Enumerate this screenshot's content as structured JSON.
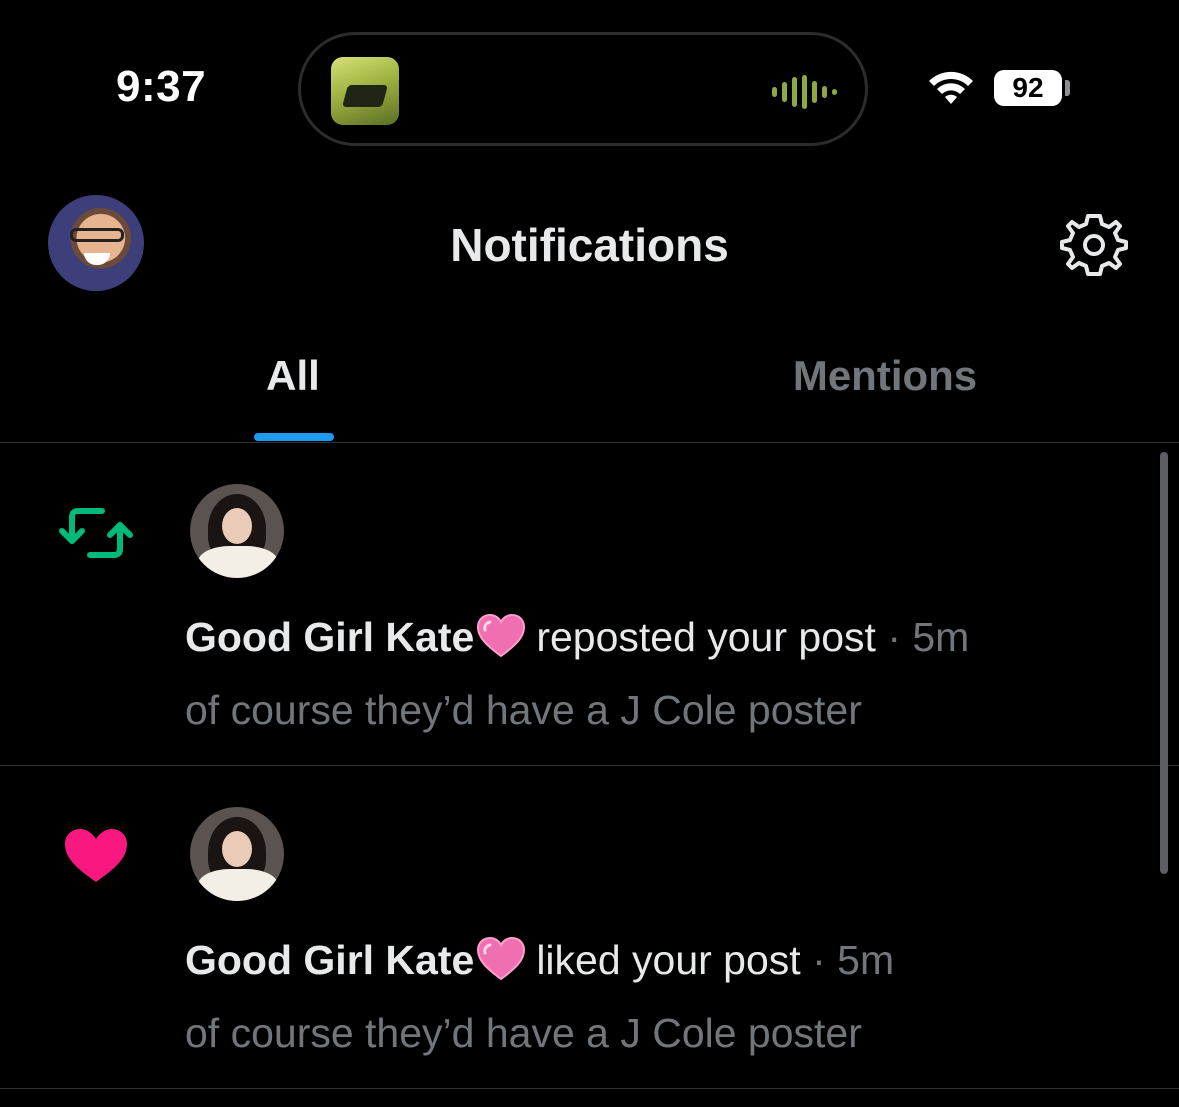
{
  "status_bar": {
    "time": "9:37",
    "battery": "92",
    "colors": {
      "waveform": "#8fa843"
    }
  },
  "header": {
    "title": "Notifications",
    "settings_icon": "gear-icon"
  },
  "tabs": [
    {
      "label": "All",
      "active": true
    },
    {
      "label": "Mentions",
      "active": false
    }
  ],
  "notifications": [
    {
      "type": "repost",
      "icon": "repost-icon",
      "icon_color": "#00ba7c",
      "user": "Good Girl Kate",
      "action": "reposted your post",
      "separator": "·",
      "time": "5m",
      "post_text": "of course they’d have a J Cole poster"
    },
    {
      "type": "like",
      "icon": "heart-icon",
      "icon_color": "#f91880",
      "user": "Good Girl Kate",
      "action": "liked your post",
      "separator": "·",
      "time": "5m",
      "post_text": "of course they’d have a J Cole poster"
    }
  ],
  "colors": {
    "accent": "#1d9bf0",
    "background": "#000000",
    "primary_text": "#e7e9ea",
    "secondary_text": "#71767b"
  }
}
